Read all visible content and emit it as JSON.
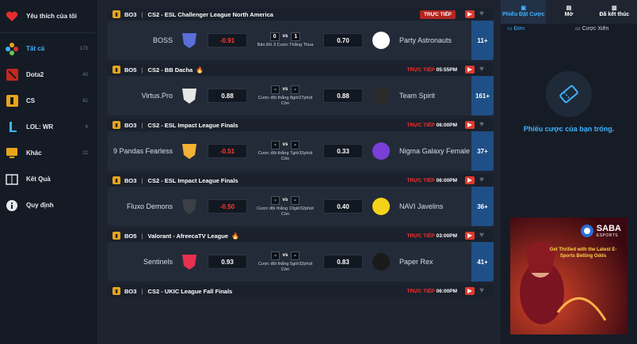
{
  "sidebar": {
    "favorites": "Yêu thích của tôi",
    "items": [
      {
        "label": "Tất cả",
        "count": "173"
      },
      {
        "label": "Dota2",
        "count": "40"
      },
      {
        "label": "CS",
        "count": "62"
      },
      {
        "label": "LOL: WR",
        "count": "6"
      },
      {
        "label": "Khác",
        "count": "22"
      },
      {
        "label": "Kết Quả",
        "count": ""
      },
      {
        "label": "Quy định",
        "count": ""
      }
    ]
  },
  "matches": [
    {
      "bo": "BO3",
      "league": "CS2 - ESL Challenger League North America",
      "status": "TRỰC TIẾP",
      "time": "",
      "team1": "BOSS",
      "odd1": "-0.91",
      "odd2": "0.70",
      "score1": "0",
      "score2": "1",
      "info": "Bản Đồ 3 Cược Thắng Thua",
      "team2": "Party Astronauts",
      "more": "11+"
    },
    {
      "bo": "BO5",
      "league": "CS2 - BB Dacha",
      "status": "TRỰC TIẾP",
      "time": "05:55PM",
      "team1": "Virtus.Pro",
      "odd1": "0.88",
      "odd2": "0.88",
      "score1": "-",
      "score2": "-",
      "info": "Cược đội thắng 8giờ27phút Còn",
      "team2": "Team Spirit",
      "more": "161+"
    },
    {
      "bo": "BO3",
      "league": "CS2 - ESL Impact League Finals",
      "status": "TRỰC TIẾP",
      "time": "06:00PM",
      "team1": "9 Pandas Fearless",
      "odd1": "-0.51",
      "odd2": "0.33",
      "score1": "-",
      "score2": "-",
      "info": "Cược đội thắng 7giờ32phút Còn",
      "team2": "Nigma Galaxy Female",
      "more": "37+"
    },
    {
      "bo": "BO3",
      "league": "CS2 - ESL Impact League Finals",
      "status": "TRỰC TIẾP",
      "time": "06:00PM",
      "team1": "Fluxo Demons",
      "odd1": "-0.50",
      "odd2": "0.40",
      "score1": "-",
      "score2": "-",
      "info": "Cược đội thắng 10giờ32phút Còn",
      "team2": "NAVI Javelins",
      "more": "36+"
    },
    {
      "bo": "BO5",
      "league": "Valorant - AfreecaTV League",
      "status": "TRỰC TIẾP",
      "time": "03:00PM",
      "team1": "Sentinels",
      "odd1": "0.93",
      "odd2": "0.83",
      "score1": "-",
      "score2": "-",
      "info": "Cược đội thắng 5giờ32phút Còn",
      "team2": "Paper Rex",
      "more": "41+"
    },
    {
      "bo": "BO3",
      "league": "CS2 - UKIC League Fall Finals",
      "status": "TRỰC TIẾP",
      "time": "06:00PM",
      "team1": "",
      "odd1": "",
      "odd2": "",
      "score1": "",
      "score2": "",
      "info": "",
      "team2": "",
      "more": ""
    }
  ],
  "betslip": {
    "tab_slip": "Phiếu Đặt Cược",
    "tab_open": "Mở",
    "tab_done": "Đã kết thúc",
    "sub_single": "Đơn",
    "sub_parlay": "Cược Xiên",
    "empty": "Phiếu cược của bạn trống."
  },
  "ad": {
    "brand": "SABA",
    "brand_sub": "ESPORTS",
    "headline": "Get Thrilled with the Latest E-Sports Betting Odds"
  },
  "colors": {
    "accent": "#3fb4ff",
    "live": "#ff2d2d",
    "more_bg": "#1f4f87"
  }
}
